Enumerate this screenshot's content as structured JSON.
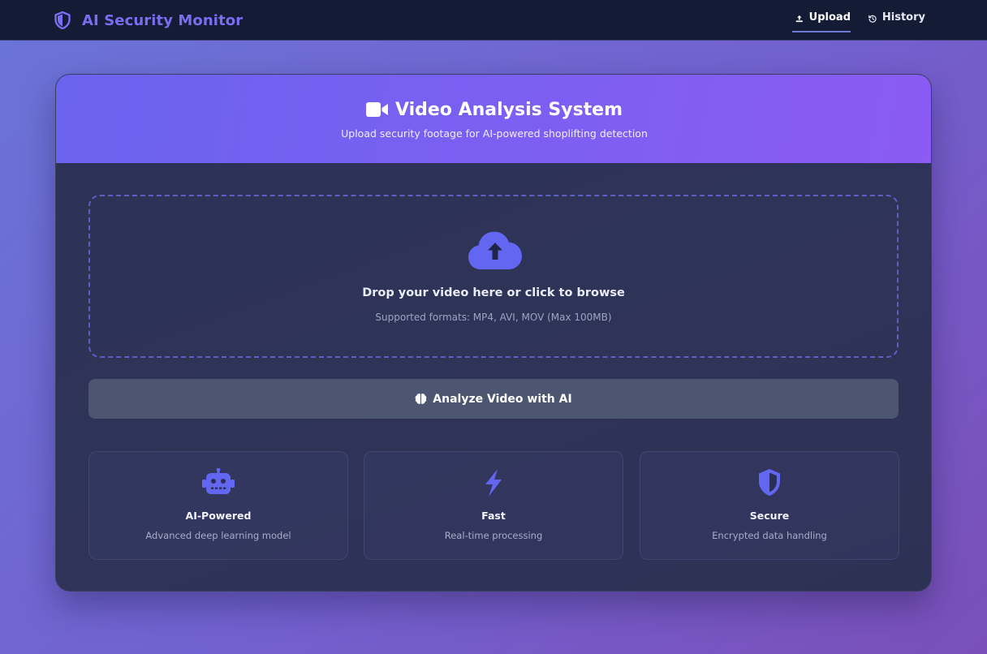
{
  "nav": {
    "brand": "AI Security Monitor",
    "brand_icon": "shield-icon",
    "links": [
      {
        "label": "Upload",
        "icon": "upload-icon",
        "active": true
      },
      {
        "label": "History",
        "icon": "history-icon",
        "active": false
      }
    ]
  },
  "card": {
    "title": "Video Analysis System",
    "title_icon": "video-camera-icon",
    "subtitle": "Upload security footage for AI-powered shoplifting detection"
  },
  "dropzone": {
    "icon": "cloud-upload-icon",
    "title": "Drop your video here or click to browse",
    "hint": "Supported formats: MP4, AVI, MOV (Max 100MB)"
  },
  "analyze": {
    "label": "Analyze Video with AI",
    "icon": "brain-icon"
  },
  "features": [
    {
      "title": "AI-Powered",
      "desc": "Advanced deep learning model",
      "icon": "robot-icon"
    },
    {
      "title": "Fast",
      "desc": "Real-time processing",
      "icon": "lightning-icon"
    },
    {
      "title": "Secure",
      "desc": "Encrypted data handling",
      "icon": "shield-icon"
    }
  ],
  "colors": {
    "accent": "#6366f1",
    "header_gradient_start": "#6a63f0",
    "header_gradient_end": "#8b5bf4",
    "navbar": "#141b34",
    "button": "#4d5671"
  }
}
